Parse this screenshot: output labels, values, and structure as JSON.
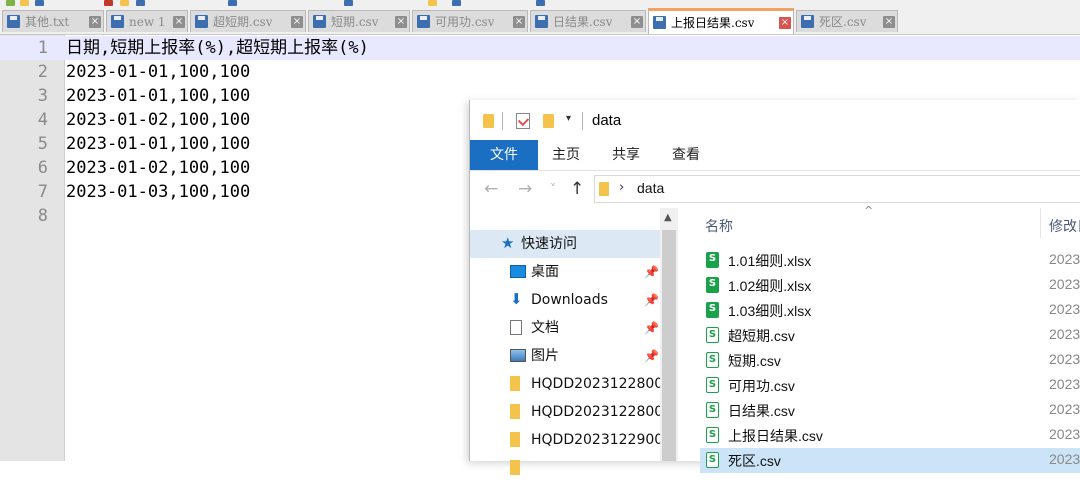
{
  "editor": {
    "tabs": [
      {
        "label": "其他.txt",
        "active": false
      },
      {
        "label": "new 1",
        "active": false
      },
      {
        "label": "超短期.csv",
        "active": false
      },
      {
        "label": "短期.csv",
        "active": false
      },
      {
        "label": "可用功.csv",
        "active": false
      },
      {
        "label": "日结果.csv",
        "active": false
      },
      {
        "label": "上报日结果.csv",
        "active": true
      },
      {
        "label": "死区.csv",
        "active": false
      }
    ],
    "close_glyph": "×",
    "line_numbers": [
      "1",
      "2",
      "3",
      "4",
      "5",
      "6",
      "7",
      "8"
    ],
    "lines": [
      "日期,短期上报率(%),超短期上报率(%)",
      "2023-01-01,100,100",
      "2023-01-01,100,100",
      "2023-01-02,100,100",
      "2023-01-01,100,100",
      "2023-01-02,100,100",
      "2023-01-03,100,100",
      ""
    ],
    "current_line": 1
  },
  "explorer": {
    "title": "data",
    "ribbon_tabs": [
      "文件",
      "主页",
      "共享",
      "查看"
    ],
    "nav": {
      "back": "←",
      "forward": "→",
      "dropdown": "˅",
      "up": "↑"
    },
    "address": {
      "chevron": "›",
      "path": "data"
    },
    "navpane": {
      "quick_access": "快速访问",
      "items": [
        {
          "label": "桌面",
          "pinned": true,
          "icon": "desktop-icon"
        },
        {
          "label": "Downloads",
          "pinned": true,
          "icon": "download-icon"
        },
        {
          "label": "文档",
          "pinned": true,
          "icon": "document-icon"
        },
        {
          "label": "图片",
          "pinned": true,
          "icon": "pictures-icon"
        },
        {
          "label": "HQDD2023122800",
          "pinned": false,
          "icon": "folder-icon"
        },
        {
          "label": "HQDD2023122800",
          "pinned": false,
          "icon": "folder-icon"
        },
        {
          "label": "HQDD2023122900",
          "pinned": false,
          "icon": "folder-icon"
        }
      ],
      "pin_glyph": "📌"
    },
    "columns": {
      "name": "名称",
      "modified": "修改日"
    },
    "files": [
      {
        "name": "1.01细则.xlsx",
        "type": "xlsx",
        "date": "2023"
      },
      {
        "name": "1.02细则.xlsx",
        "type": "xlsx",
        "date": "2023"
      },
      {
        "name": "1.03细则.xlsx",
        "type": "xlsx",
        "date": "2023"
      },
      {
        "name": "超短期.csv",
        "type": "csv",
        "date": "2023"
      },
      {
        "name": "短期.csv",
        "type": "csv",
        "date": "2023"
      },
      {
        "name": "可用功.csv",
        "type": "csv",
        "date": "2023"
      },
      {
        "name": "日结果.csv",
        "type": "csv",
        "date": "2023"
      },
      {
        "name": "上报日结果.csv",
        "type": "csv",
        "date": "2023"
      },
      {
        "name": "死区.csv",
        "type": "csv",
        "date": "2023",
        "selected": true
      }
    ],
    "file_icon_glyph": "S"
  },
  "colors": {
    "accent": "#1a6fc2",
    "current_line": "#e8e8ff",
    "active_tab": "#f4a261",
    "selection": "#cce4f7"
  }
}
